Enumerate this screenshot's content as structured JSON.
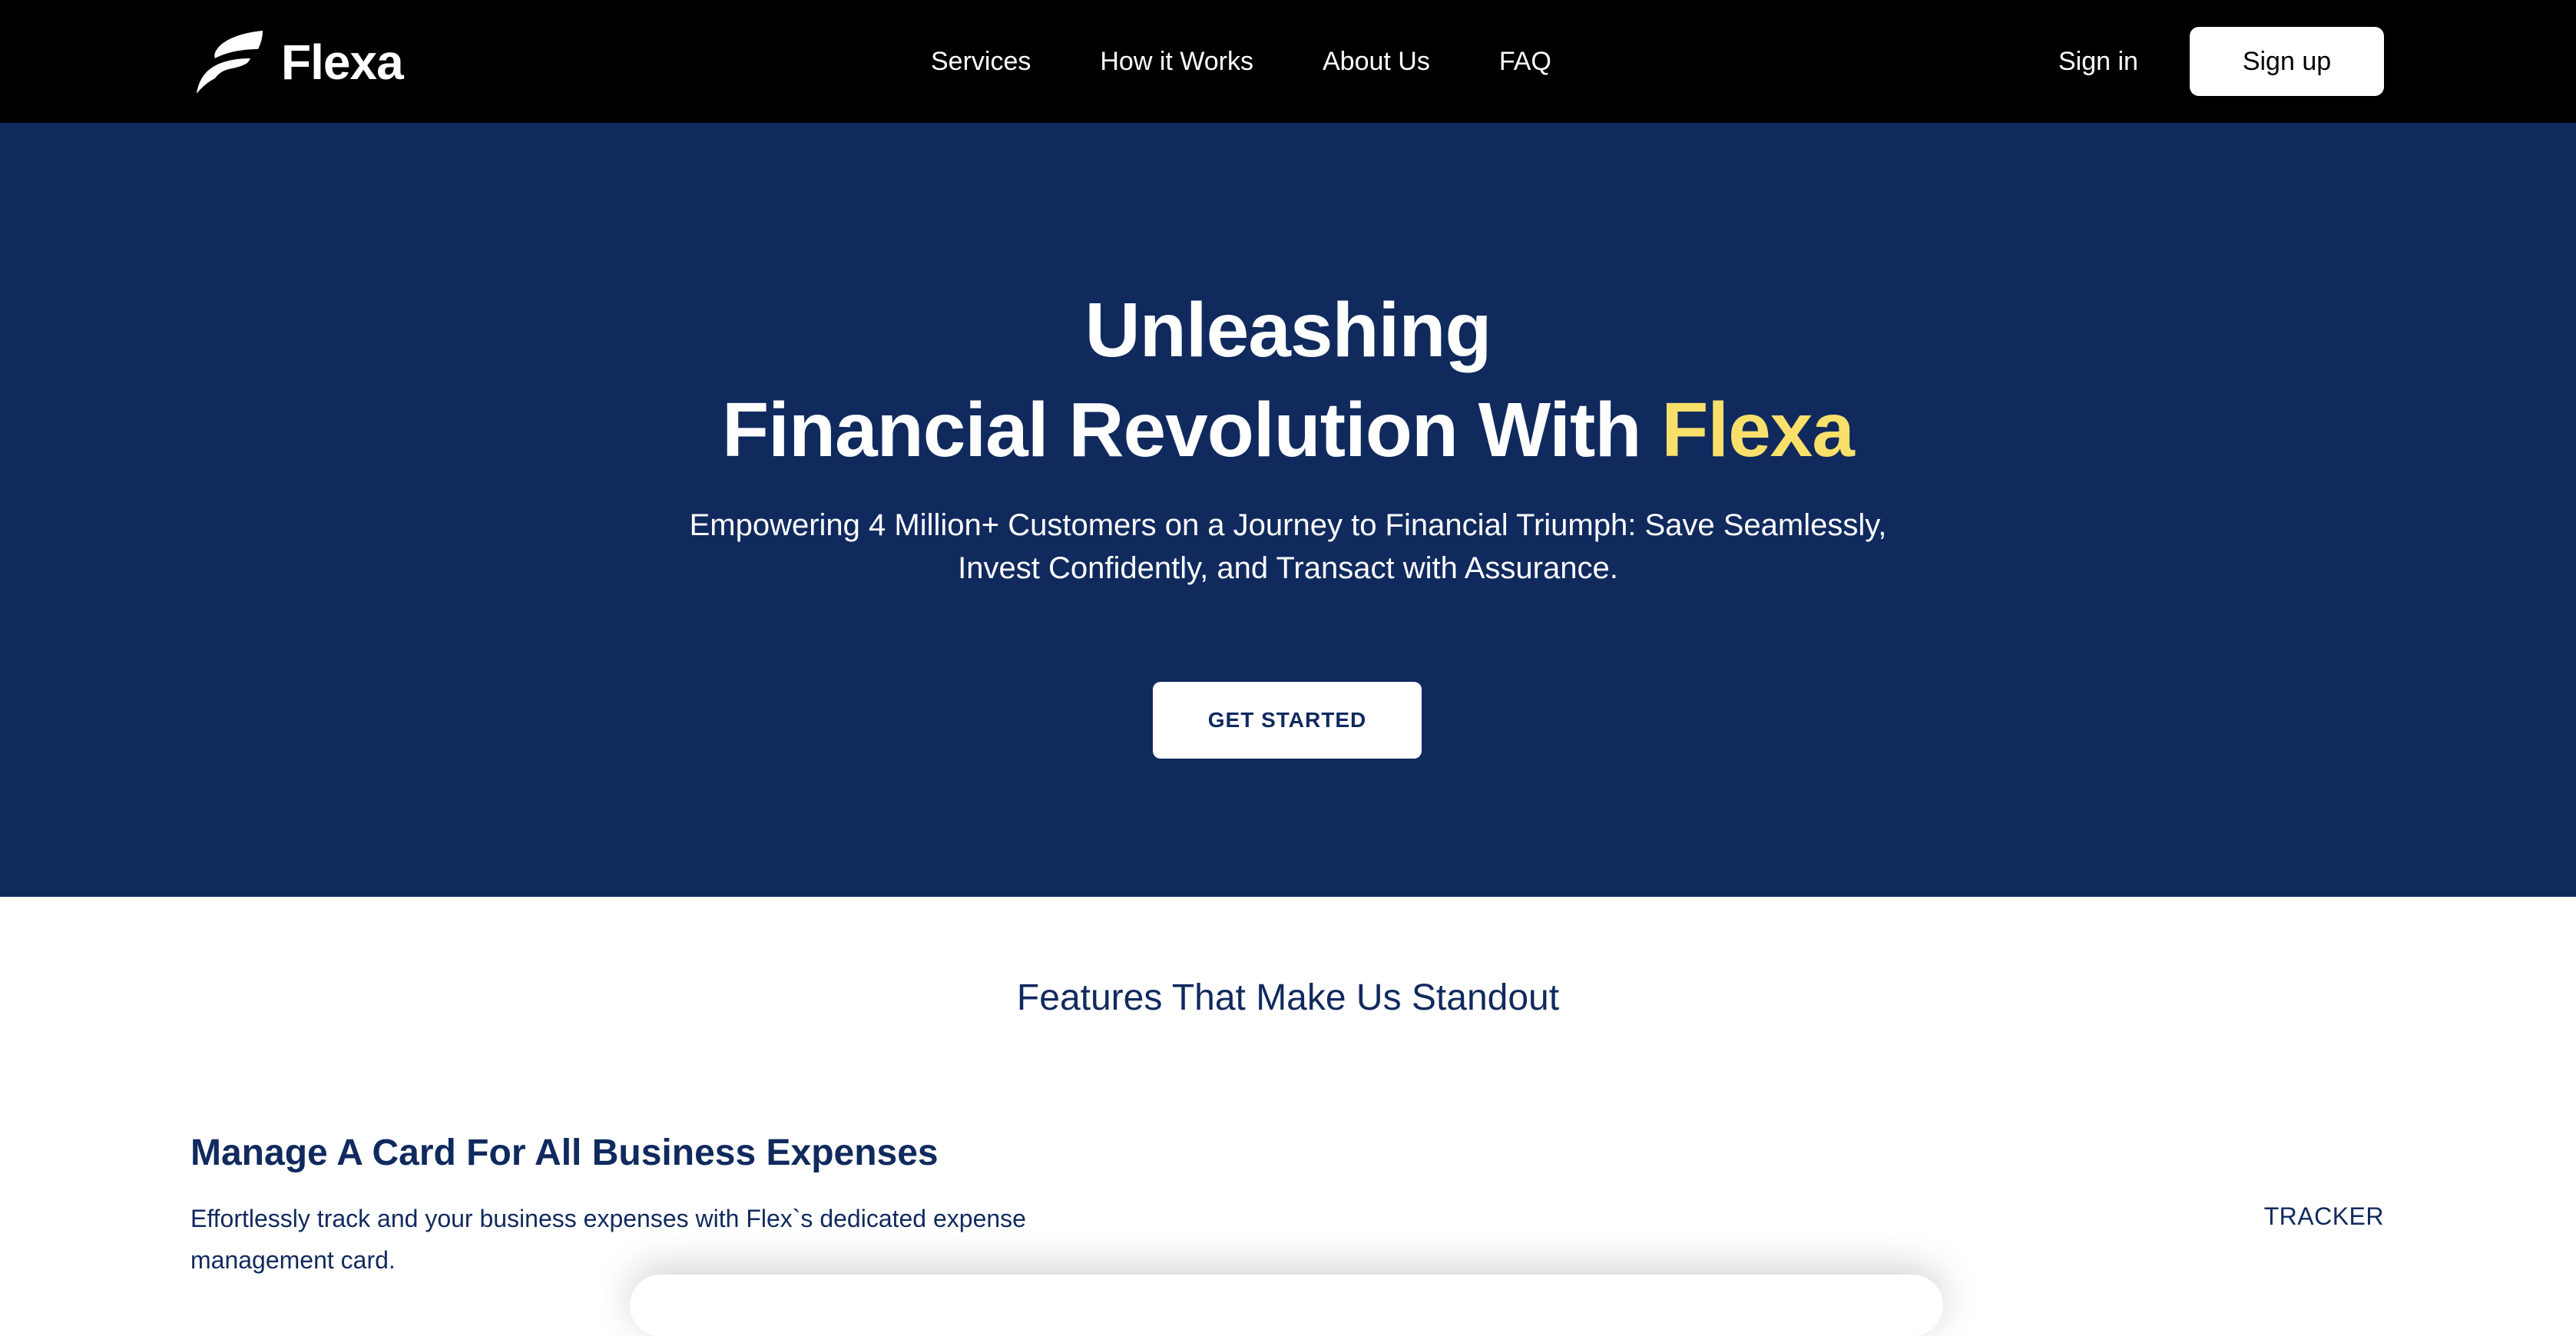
{
  "nav": {
    "brand": "Flexa",
    "links": [
      "Services",
      "How it Works",
      "About Us",
      "FAQ"
    ],
    "signin_label": "Sign in",
    "signup_label": "Sign up"
  },
  "hero": {
    "title_line1": "Unleashing",
    "title_line2_prefix": "Financial Revolution With ",
    "title_line2_accent": "Flexa",
    "subtitle": "Empowering 4 Million+ Customers on a Journey to Financial Triumph: Save Seamlessly, Invest Confidently, and Transact with Assurance.",
    "cta_label": "GET STARTED"
  },
  "features": {
    "heading": "Features That Make Us Standout",
    "items": [
      {
        "title": "Manage A Card For All Business Expenses",
        "description": "Effortlessly track and your business expenses with Flex`s dedicated expense management card.",
        "tag": "TRACKER"
      }
    ]
  },
  "colors": {
    "nav_bg": "#000000",
    "hero_bg": "#102a5e",
    "accent_yellow": "#f9e06b",
    "text_navy": "#102a5e",
    "white": "#ffffff"
  },
  "icons": {
    "logo": "flexa-logo-icon"
  }
}
